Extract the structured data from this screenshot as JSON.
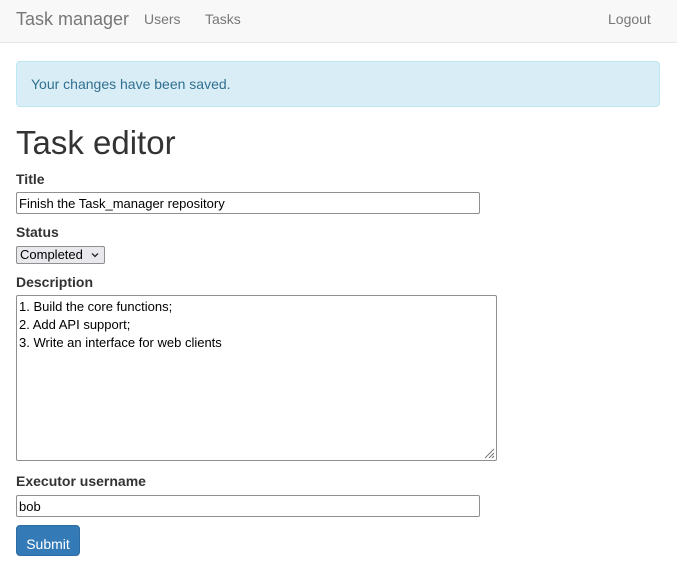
{
  "navbar": {
    "brand": "Task manager",
    "links": [
      "Users",
      "Tasks"
    ],
    "logout": "Logout"
  },
  "alert": {
    "message": "Your changes have been saved."
  },
  "page_title": "Task editor",
  "form": {
    "title_label": "Title",
    "title_value": "Finish the Task_manager repository",
    "status_label": "Status",
    "status_value": "Completed",
    "description_label": "Description",
    "description_lines": [
      "1. Build the core functions;",
      "2. Add API support;",
      "3. Write an interface for web clients"
    ],
    "executor_label": "Executor username",
    "executor_value": "bob",
    "submit_label": "Submit"
  },
  "colors": {
    "navbar_bg": "#f8f8f8",
    "alert_bg": "#d9edf7",
    "alert_text": "#31708f",
    "primary": "#337ab7"
  },
  "icons": [
    "chevron-down-icon",
    "resize-grip-icon"
  ]
}
